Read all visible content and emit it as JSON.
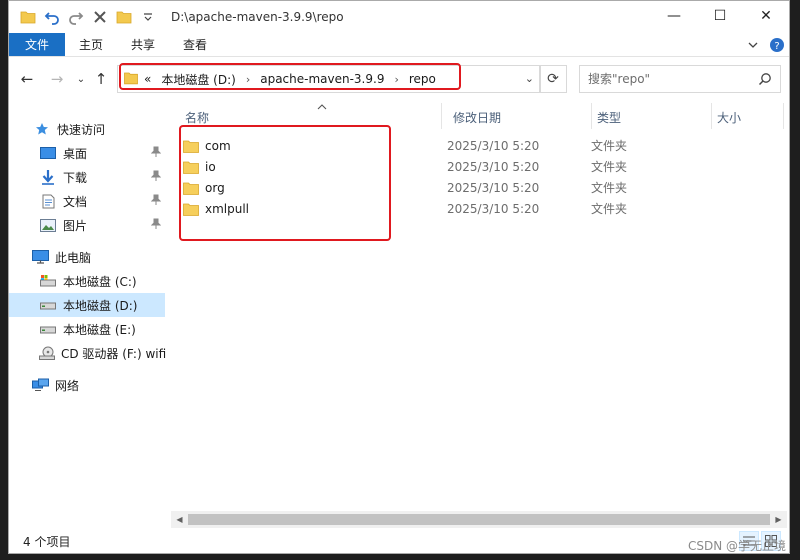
{
  "window": {
    "path_title": "D:\\apache-maven-3.9.9\\repo",
    "controls": {
      "minimize": "—",
      "maximize": "☐",
      "close": "✕"
    }
  },
  "ribbon": {
    "tabs": [
      "文件",
      "主页",
      "共享",
      "查看"
    ]
  },
  "nav": {
    "back": "←",
    "forward": "→",
    "recent": "⌄",
    "up": "↑"
  },
  "address": {
    "overflow": "«",
    "crumbs": [
      "本地磁盘 (D:)",
      "apache-maven-3.9.9",
      "repo"
    ],
    "separator": "›",
    "dropdown": "⌄",
    "refresh": "⟳"
  },
  "search": {
    "placeholder": "搜索\"repo\""
  },
  "sidebar": {
    "items": [
      {
        "label": "快速访问",
        "icon": "star-icon"
      },
      {
        "label": "桌面",
        "icon": "desktop-icon",
        "pinned": true
      },
      {
        "label": "下载",
        "icon": "download-icon",
        "pinned": true
      },
      {
        "label": "文档",
        "icon": "document-icon",
        "pinned": true
      },
      {
        "label": "图片",
        "icon": "picture-icon",
        "pinned": true
      },
      {
        "label": "此电脑",
        "icon": "computer-icon"
      },
      {
        "label": "本地磁盘 (C:)",
        "icon": "drive-icon"
      },
      {
        "label": "本地磁盘 (D:)",
        "icon": "drive-icon",
        "selected": true
      },
      {
        "label": "本地磁盘 (E:)",
        "icon": "drive-icon"
      },
      {
        "label": "CD 驱动器 (F:) wifi",
        "icon": "cd-drive-icon"
      },
      {
        "label": "网络",
        "icon": "network-icon"
      }
    ]
  },
  "columns": [
    "名称",
    "修改日期",
    "类型",
    "大小"
  ],
  "files": [
    {
      "name": "com",
      "date": "2025/3/10 5:20",
      "type": "文件夹"
    },
    {
      "name": "io",
      "date": "2025/3/10 5:20",
      "type": "文件夹"
    },
    {
      "name": "org",
      "date": "2025/3/10 5:20",
      "type": "文件夹"
    },
    {
      "name": "xmlpull",
      "date": "2025/3/10 5:20",
      "type": "文件夹"
    }
  ],
  "status": {
    "count": "4 个项目"
  },
  "watermark": "CSDN @学无止境"
}
